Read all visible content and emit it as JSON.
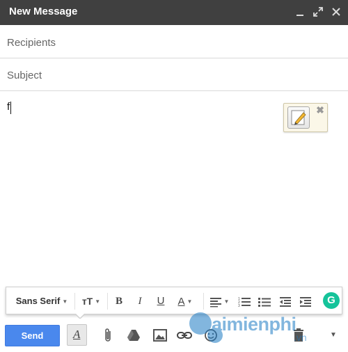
{
  "window": {
    "title": "New Message",
    "controls": {
      "minimize": "minimize-icon",
      "popout": "expand-icon",
      "close": "close-icon"
    }
  },
  "recipients": {
    "placeholder": "Recipients",
    "value": ""
  },
  "subject": {
    "placeholder": "Subject",
    "value": ""
  },
  "body": {
    "text": "f"
  },
  "note_widget": {
    "icon": "pencil-note-icon",
    "close_label": "✖"
  },
  "format_toolbar": {
    "font": "Sans Serif",
    "size_icon": "text-size-icon",
    "size_glyph": "тT",
    "bold": "B",
    "italic": "I",
    "underline": "U",
    "text_color": "A",
    "icons": [
      "text-size-icon",
      "bold-icon",
      "italic-icon",
      "underline-icon",
      "text-color-icon",
      "align-icon",
      "numbered-list-icon",
      "bulleted-list-icon",
      "indent-less-icon",
      "indent-more-icon",
      "grammarly-icon"
    ],
    "grammarly_letter": "G"
  },
  "bottom_toolbar": {
    "send_label": "Send",
    "format_toggle_letter": "A",
    "icons": [
      "attach-icon",
      "drive-icon",
      "photo-icon",
      "link-icon",
      "emoji-icon",
      "trash-icon",
      "more-options-icon"
    ]
  },
  "watermark": {
    "brand": "aimienphi",
    "suffix": ".vn"
  },
  "colors": {
    "titlebar": "#404040",
    "send": "#4a88ed",
    "grammarly": "#15c39a",
    "watermark": "#1d7bc4"
  }
}
